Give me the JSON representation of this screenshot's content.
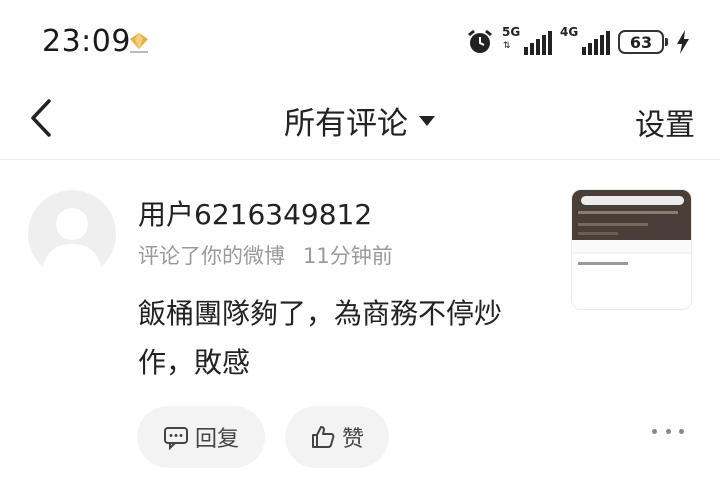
{
  "status_bar": {
    "time": "23:09",
    "network_1": "5G",
    "network_2": "4G",
    "battery": "63",
    "icons": [
      "honor-badge-icon",
      "alarm-icon",
      "signal-icon",
      "battery-icon",
      "charging-bolt-icon"
    ]
  },
  "nav": {
    "back_icon": "chevron-left-icon",
    "title": "所有评论",
    "title_icon": "caret-down-icon",
    "settings_label": "设置"
  },
  "comment": {
    "avatar_icon": "default-avatar-icon",
    "username": "用户6216349812",
    "action": "评论了你的微博",
    "time_ago": "11分钟前",
    "text": "飯桶團隊夠了，為商務不停炒作，敗感",
    "thumbnail": {
      "description_icon": "post-thumbnail"
    },
    "reply_label": "回复",
    "reply_icon": "comment-icon",
    "like_label": "赞",
    "like_icon": "thumbs-up-icon",
    "more_icon": "more-dots-icon"
  },
  "colors": {
    "text_primary": "#222222",
    "text_secondary": "#9a9a9a",
    "button_bg": "#f3f3f3",
    "divider": "#ececec"
  }
}
